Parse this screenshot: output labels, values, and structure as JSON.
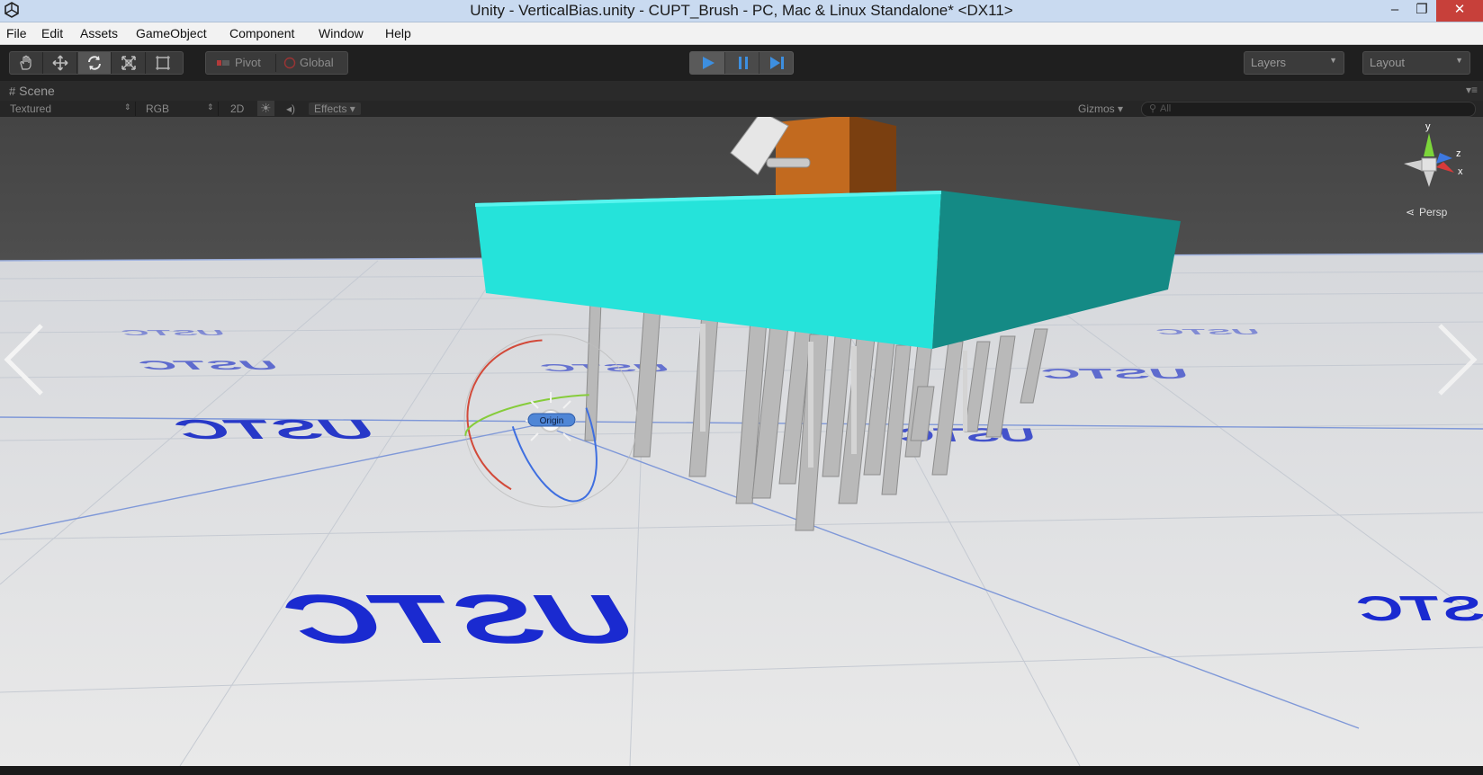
{
  "window": {
    "title": "Unity - VerticalBias.unity - CUPT_Brush - PC, Mac & Linux Standalone* <DX11>",
    "minimize_glyph": "–",
    "maximize_glyph": "❐",
    "close_glyph": "✕"
  },
  "menu": {
    "items": [
      "File",
      "Edit",
      "Assets",
      "GameObject",
      "Component",
      "Window",
      "Help"
    ]
  },
  "toolbar": {
    "tools": [
      "hand-icon",
      "move-icon",
      "rotate-icon",
      "scale-icon",
      "rect-tool-icon"
    ],
    "active_tool": "rotate-icon",
    "pivot_label": "Pivot",
    "global_label": "Global",
    "play_controls": [
      "play-icon",
      "pause-icon",
      "step-icon"
    ],
    "layers_label": "Layers",
    "layout_label": "Layout"
  },
  "scene": {
    "tab_label": "Scene",
    "draw_mode": "Textured",
    "render_mode": "RGB",
    "mode_2d": "2D",
    "effects_label": "Effects",
    "gizmos_label": "Gizmos",
    "search_placeholder": "All",
    "persp_label": "Persp",
    "axis_y": "y",
    "axis_z": "z",
    "axis_x": "x",
    "origin_label": "Origin",
    "floor_text": "USTC"
  },
  "colors": {
    "title_bg": "#c9daf0",
    "toolbar_bg": "#1f1f1f",
    "cyan_block": "#25e3da",
    "cyan_block_side": "#148a85",
    "orange_box": "#c26a1f",
    "floor": "#e6e6e6",
    "ustc_text": "#1a2ad0",
    "play_accent": "#3d8fe0"
  }
}
